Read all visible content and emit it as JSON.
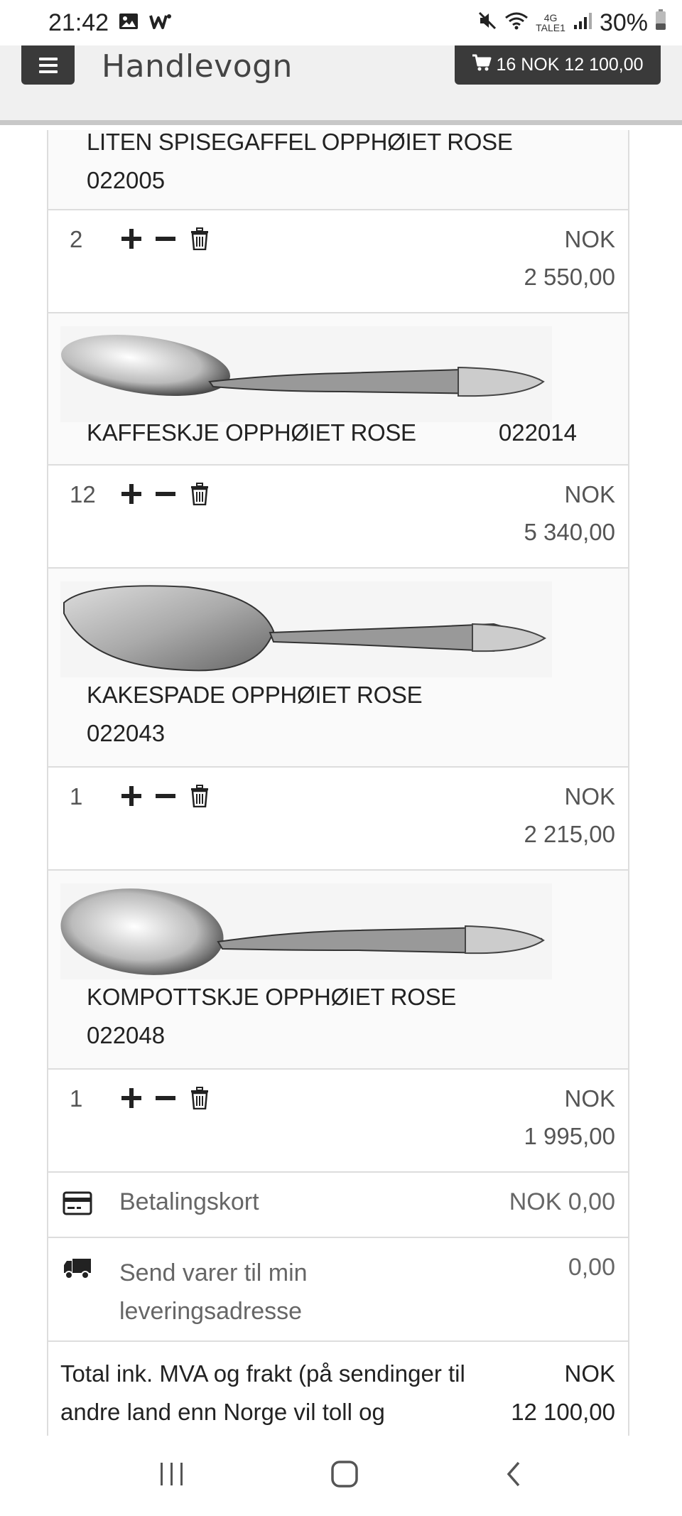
{
  "status_bar": {
    "time": "21:42",
    "network_top": "4G",
    "network_bottom": "TALE1",
    "battery": "30%",
    "icons": [
      "image-icon",
      "w-app-icon",
      "mute-icon",
      "wifi-icon",
      "signal-icon",
      "battery-icon"
    ]
  },
  "header": {
    "title": "Handlevogn",
    "cart_summary": "16 NOK 12 100,00"
  },
  "items": [
    {
      "name": "LITEN SPISEGAFFEL OPPHØIET ROSE",
      "code": "022005",
      "qty": "2",
      "currency": "NOK",
      "price": "2 550,00"
    },
    {
      "name": "KAFFESKJE OPPHØIET ROSE",
      "code": "022014",
      "qty": "12",
      "currency": "NOK",
      "price": "5 340,00"
    },
    {
      "name": "KAKESPADE OPPHØIET ROSE",
      "code": "022043",
      "qty": "1",
      "currency": "NOK",
      "price": "2 215,00"
    },
    {
      "name": "KOMPOTTSKJE OPPHØIET ROSE",
      "code": "022048",
      "qty": "1",
      "currency": "NOK",
      "price": "1 995,00"
    }
  ],
  "payment": {
    "label": "Betalingskort",
    "value": "NOK 0,00"
  },
  "shipping": {
    "label": "Send varer til min leveringsadresse",
    "value": "0,00"
  },
  "total": {
    "label": "Total ink. MVA og frakt (på sendinger til andre land enn Norge vil toll og",
    "currency": "NOK",
    "value": "12 100,00"
  },
  "colors": {
    "header_bg": "#f0f0f0",
    "button_bg": "#3a3a3a",
    "border": "#dddddd"
  }
}
